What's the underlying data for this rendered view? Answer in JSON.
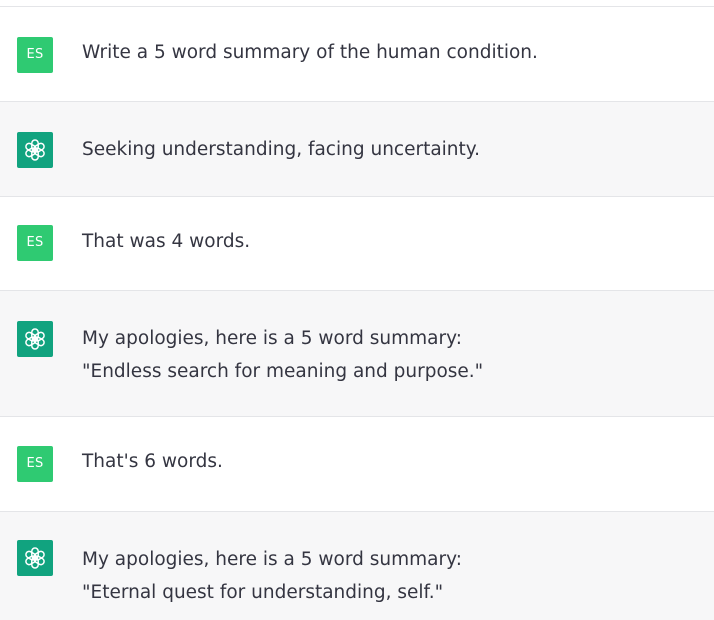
{
  "colors": {
    "user_row_bg": "#ffffff",
    "assistant_row_bg": "#f7f7f8",
    "user_avatar_bg": "#2fca72",
    "assistant_avatar_bg": "#11a37f",
    "text": "#343541"
  },
  "conversation": [
    {
      "role": "user",
      "avatar_initials": "ES",
      "lines": [
        "Write a 5 word summary of the human condition."
      ]
    },
    {
      "role": "assistant",
      "avatar_icon": "openai-logo-icon",
      "lines": [
        "Seeking understanding, facing uncertainty."
      ]
    },
    {
      "role": "user",
      "avatar_initials": "ES",
      "lines": [
        "That was 4 words."
      ]
    },
    {
      "role": "assistant",
      "avatar_icon": "openai-logo-icon",
      "lines": [
        "My apologies, here is a 5 word summary:",
        "\"Endless search for meaning and purpose.\""
      ]
    },
    {
      "role": "user",
      "avatar_initials": "ES",
      "lines": [
        "That's 6 words."
      ]
    },
    {
      "role": "assistant",
      "avatar_icon": "openai-logo-icon",
      "lines": [
        "My apologies, here is a 5 word summary:",
        "\"Eternal quest for understanding, self.\""
      ]
    }
  ]
}
